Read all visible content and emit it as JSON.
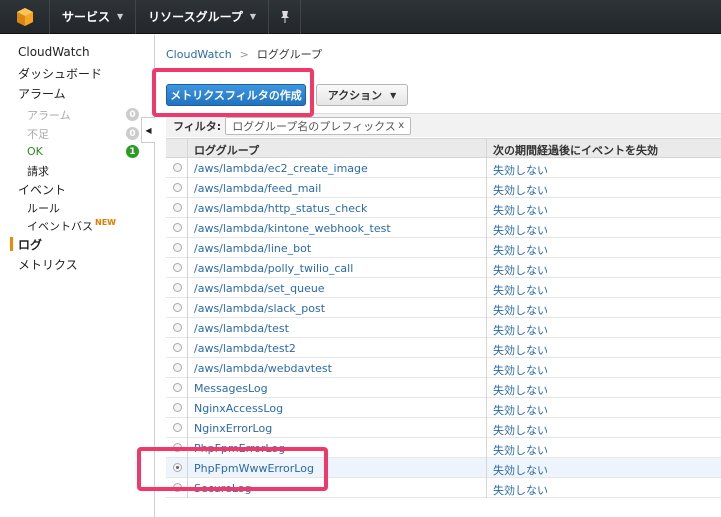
{
  "topbar": {
    "services_label": "サービス",
    "resource_groups_label": "リソースグループ"
  },
  "sidebar": {
    "title": "CloudWatch",
    "dashboard": "ダッシュボード",
    "alarms": "アラーム",
    "alarm_sub": {
      "label": "アラーム",
      "count": "0"
    },
    "insufficient_sub": {
      "label": "不足",
      "count": "0"
    },
    "ok_sub": {
      "label": "OK",
      "count": "1"
    },
    "billing_sub": "請求",
    "events": "イベント",
    "rules_sub": "ルール",
    "eventbus_sub": "イベントバス",
    "new_tag": "NEW",
    "logs": "ログ",
    "metrics": "メトリクス"
  },
  "breadcrumb": {
    "root": "CloudWatch",
    "separator": ">",
    "current": "ロググループ"
  },
  "toolbar": {
    "create_metric_filter": "メトリクスフィルタの作成",
    "actions": "アクション"
  },
  "filter": {
    "label": "フィルタ:",
    "placeholder": "ロググループ名のプレフィックス",
    "clear": "x"
  },
  "table": {
    "columns": [
      "ロググループ",
      "次の期間経過後にイベントを失効"
    ],
    "rows": [
      {
        "name": "/aws/lambda/ec2_create_image",
        "expire": "失効しない"
      },
      {
        "name": "/aws/lambda/feed_mail",
        "expire": "失効しない"
      },
      {
        "name": "/aws/lambda/http_status_check",
        "expire": "失効しない"
      },
      {
        "name": "/aws/lambda/kintone_webhook_test",
        "expire": "失効しない"
      },
      {
        "name": "/aws/lambda/line_bot",
        "expire": "失効しない"
      },
      {
        "name": "/aws/lambda/polly_twilio_call",
        "expire": "失効しない"
      },
      {
        "name": "/aws/lambda/set_queue",
        "expire": "失効しない"
      },
      {
        "name": "/aws/lambda/slack_post",
        "expire": "失効しない"
      },
      {
        "name": "/aws/lambda/test",
        "expire": "失効しない"
      },
      {
        "name": "/aws/lambda/test2",
        "expire": "失効しない"
      },
      {
        "name": "/aws/lambda/webdavtest",
        "expire": "失効しない"
      },
      {
        "name": "MessagesLog",
        "expire": "失効しない"
      },
      {
        "name": "NginxAccessLog",
        "expire": "失効しない"
      },
      {
        "name": "NginxErrorLog",
        "expire": "失効しない"
      },
      {
        "name": "PhpFpmErrorLog",
        "expire": "失効しない"
      },
      {
        "name": "PhpFpmWwwErrorLog",
        "expire": "失効しない",
        "selected": true
      },
      {
        "name": "SecureLog",
        "expire": "失効しない"
      }
    ]
  },
  "colors": {
    "highlight": "#f0386b",
    "primary_button": "#1f73c0",
    "link": "#2a6aaa"
  }
}
